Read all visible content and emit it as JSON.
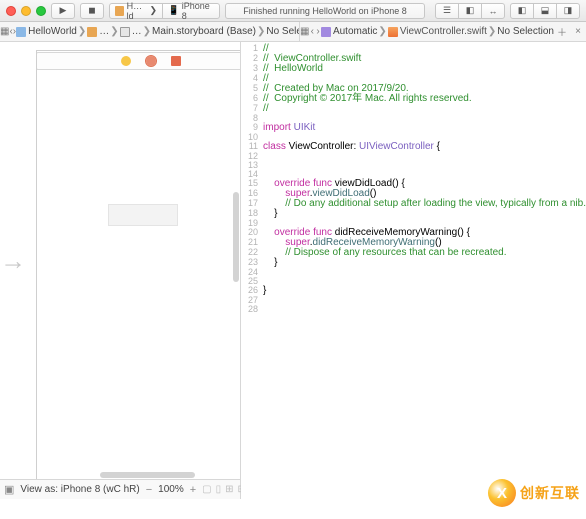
{
  "toolbar": {
    "scheme_target": "H…ld",
    "scheme_device": "iPhone 8",
    "status": "Finished running HelloWorld on iPhone 8"
  },
  "pathbar_left": {
    "project": "HelloWorld",
    "folder": "…",
    "file": "Main.storyboard (Base)",
    "sel": "No Selection"
  },
  "pathbar_right": {
    "mode": "Automatic",
    "file": "ViewController.swift",
    "sel": "No Selection"
  },
  "ib_footer": {
    "view_as": "View as: iPhone 8 (wC hR)",
    "zoom": "100%"
  },
  "code_lines": [
    {
      "n": 1,
      "cls": "c-comment",
      "t": "//"
    },
    {
      "n": 2,
      "cls": "c-comment",
      "t": "//  ViewController.swift"
    },
    {
      "n": 3,
      "cls": "c-comment",
      "t": "//  HelloWorld"
    },
    {
      "n": 4,
      "cls": "c-comment",
      "t": "//"
    },
    {
      "n": 5,
      "cls": "c-comment",
      "t": "//  Created by Mac on 2017/9/20."
    },
    {
      "n": 6,
      "cls": "c-comment",
      "t": "//  Copyright © 2017年 Mac. All rights reserved."
    },
    {
      "n": 7,
      "cls": "c-comment",
      "t": "//"
    },
    {
      "n": 8,
      "cls": "",
      "t": ""
    },
    {
      "n": 9,
      "cls": "",
      "html": "<span class=\"c-keyword\">import</span> <span class=\"c-type\">UIKit</span>"
    },
    {
      "n": 10,
      "cls": "",
      "t": ""
    },
    {
      "n": 11,
      "cls": "",
      "html": "<span class=\"c-keyword\">class</span> ViewController: <span class=\"c-type\">UIViewController</span> {"
    },
    {
      "n": 12,
      "cls": "",
      "t": ""
    },
    {
      "n": 13,
      "cls": "",
      "t": ""
    },
    {
      "n": 14,
      "cls": "",
      "t": ""
    },
    {
      "n": 15,
      "cls": "",
      "html": "    <span class=\"c-keyword\">override func</span> viewDidLoad() {"
    },
    {
      "n": 16,
      "cls": "",
      "html": "        <span class=\"c-keyword\">super</span>.<span class=\"c-method\">viewDidLoad</span>()"
    },
    {
      "n": 17,
      "cls": "c-comment",
      "t": "        // Do any additional setup after loading the view, typically from a nib."
    },
    {
      "n": 18,
      "cls": "",
      "t": "    }"
    },
    {
      "n": 19,
      "cls": "",
      "t": ""
    },
    {
      "n": 20,
      "cls": "",
      "html": "    <span class=\"c-keyword\">override func</span> didReceiveMemoryWarning() {"
    },
    {
      "n": 21,
      "cls": "",
      "html": "        <span class=\"c-keyword\">super</span>.<span class=\"c-method\">didReceiveMemoryWarning</span>()"
    },
    {
      "n": 22,
      "cls": "c-comment",
      "t": "        // Dispose of any resources that can be recreated."
    },
    {
      "n": 23,
      "cls": "",
      "t": "    }"
    },
    {
      "n": 24,
      "cls": "",
      "t": ""
    },
    {
      "n": 25,
      "cls": "",
      "t": ""
    },
    {
      "n": 26,
      "cls": "",
      "t": "}"
    },
    {
      "n": 27,
      "cls": "",
      "t": ""
    },
    {
      "n": 28,
      "cls": "",
      "t": ""
    }
  ],
  "watermark": {
    "initial": "X",
    "text": "创新互联"
  }
}
